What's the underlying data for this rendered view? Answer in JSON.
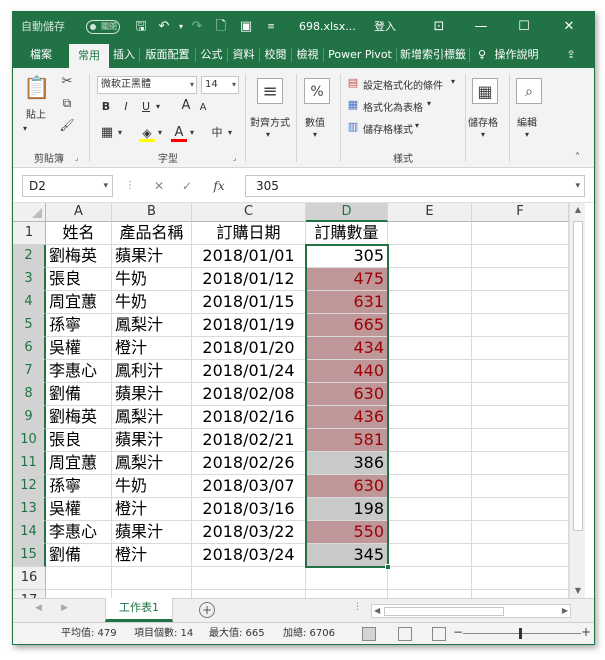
{
  "titlebar": {
    "autosave_label": "自動儲存",
    "autosave_state": "關閉",
    "filename": "698.xlsx...",
    "signin": "登入"
  },
  "tabs": [
    "檔案",
    "常用",
    "插入",
    "版面配置",
    "公式",
    "資料",
    "校閱",
    "檢視",
    "Power Pivot",
    "新增索引標籤",
    "操作說明"
  ],
  "ribbon": {
    "clipboard": {
      "paste": "貼上",
      "label": "剪貼簿"
    },
    "font": {
      "name": "微軟正黑體",
      "size": "14",
      "label": "字型",
      "bold": "B",
      "italic": "I",
      "underline": "U",
      "grow": "A",
      "shrink": "A",
      "phonetic": "中",
      "color_a": "A"
    },
    "alignment": {
      "label": "對齊方式"
    },
    "number": {
      "label": "數值",
      "symbol": "%"
    },
    "styles": {
      "conditional": "設定格式化的條件",
      "as_table": "格式化為表格",
      "cell_styles": "儲存格樣式",
      "label": "樣式"
    },
    "cells": {
      "label": "儲存格"
    },
    "editing": {
      "label": "編輯"
    }
  },
  "formula_bar": {
    "name_box": "D2",
    "value": "305",
    "fx": "fx"
  },
  "grid": {
    "columns": [
      "A",
      "B",
      "C",
      "D",
      "E",
      "F"
    ],
    "rows": [
      {
        "n": "1",
        "a": "姓名",
        "b": "產品名稱",
        "c": "訂購日期",
        "d": "訂購數量",
        "hl": "none"
      },
      {
        "n": "2",
        "a": "劉梅英",
        "b": "蘋果汁",
        "c": "2018/01/01",
        "d": "305",
        "hl": "white"
      },
      {
        "n": "3",
        "a": "張良",
        "b": "牛奶",
        "c": "2018/01/12",
        "d": "475",
        "hl": "red"
      },
      {
        "n": "4",
        "a": "周宜蕙",
        "b": "牛奶",
        "c": "2018/01/15",
        "d": "631",
        "hl": "red"
      },
      {
        "n": "5",
        "a": "孫寧",
        "b": "鳳梨汁",
        "c": "2018/01/19",
        "d": "665",
        "hl": "red"
      },
      {
        "n": "6",
        "a": "吳權",
        "b": "橙汁",
        "c": "2018/01/20",
        "d": "434",
        "hl": "red"
      },
      {
        "n": "7",
        "a": "李惠心",
        "b": "鳳利汁",
        "c": "2018/01/24",
        "d": "440",
        "hl": "red"
      },
      {
        "n": "8",
        "a": "劉備",
        "b": "蘋果汁",
        "c": "2018/02/08",
        "d": "630",
        "hl": "red"
      },
      {
        "n": "9",
        "a": "劉梅英",
        "b": "鳳梨汁",
        "c": "2018/02/16",
        "d": "436",
        "hl": "red"
      },
      {
        "n": "10",
        "a": "張良",
        "b": "蘋果汁",
        "c": "2018/02/21",
        "d": "581",
        "hl": "red"
      },
      {
        "n": "11",
        "a": "周宜蕙",
        "b": "鳳梨汁",
        "c": "2018/02/26",
        "d": "386",
        "hl": "grey"
      },
      {
        "n": "12",
        "a": "孫寧",
        "b": "牛奶",
        "c": "2018/03/07",
        "d": "630",
        "hl": "red"
      },
      {
        "n": "13",
        "a": "吳權",
        "b": "橙汁",
        "c": "2018/03/16",
        "d": "198",
        "hl": "grey"
      },
      {
        "n": "14",
        "a": "李惠心",
        "b": "蘋果汁",
        "c": "2018/03/22",
        "d": "550",
        "hl": "red"
      },
      {
        "n": "15",
        "a": "劉備",
        "b": "橙汁",
        "c": "2018/03/24",
        "d": "345",
        "hl": "grey"
      },
      {
        "n": "16",
        "a": "",
        "b": "",
        "c": "",
        "d": "",
        "hl": "none"
      },
      {
        "n": "17",
        "a": "",
        "b": "",
        "c": "",
        "d": "",
        "hl": "none"
      }
    ]
  },
  "sheet": {
    "tab": "工作表1",
    "add": "+"
  },
  "status": {
    "average": "平均值: 479",
    "count": "項目個數: 14",
    "max": "最大值: 665",
    "sum": "加總: 6706"
  },
  "colors": {
    "brand": "#217346",
    "highlight_red_fill": "#c09799",
    "highlight_red_text": "#9c0006",
    "highlight_grey_fill": "#c9c9c9"
  }
}
